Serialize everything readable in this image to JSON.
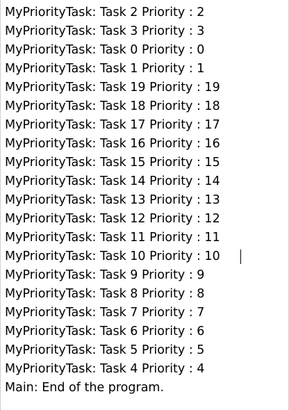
{
  "console": {
    "lines": [
      "MyPriorityTask: Task 2 Priority : 2",
      "MyPriorityTask: Task 3 Priority : 3",
      "MyPriorityTask: Task 0 Priority : 0",
      "MyPriorityTask: Task 1 Priority : 1",
      "MyPriorityTask: Task 19 Priority : 19",
      "MyPriorityTask: Task 18 Priority : 18",
      "MyPriorityTask: Task 17 Priority : 17",
      "MyPriorityTask: Task 16 Priority : 16",
      "MyPriorityTask: Task 15 Priority : 15",
      "MyPriorityTask: Task 14 Priority : 14",
      "MyPriorityTask: Task 13 Priority : 13",
      "MyPriorityTask: Task 12 Priority : 12",
      "MyPriorityTask: Task 11 Priority : 11",
      "MyPriorityTask: Task 10 Priority : 10",
      "MyPriorityTask: Task 9 Priority : 9",
      "MyPriorityTask: Task 8 Priority : 8",
      "MyPriorityTask: Task 7 Priority : 7",
      "MyPriorityTask: Task 6 Priority : 6",
      "MyPriorityTask: Task 5 Priority : 5",
      "MyPriorityTask: Task 4 Priority : 4",
      "Main: End of the program."
    ]
  }
}
